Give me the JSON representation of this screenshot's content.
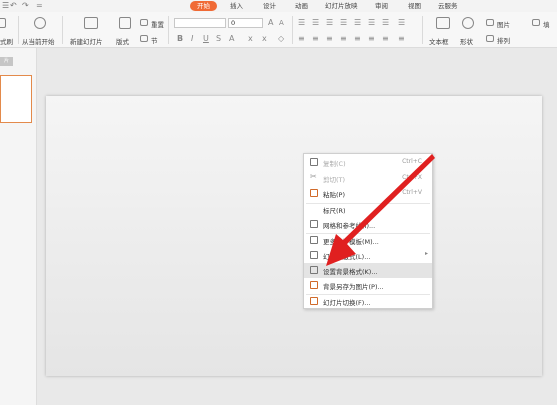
{
  "quick_access": {
    "logo_glyph": "☰",
    "undo_glyph": "↶",
    "redo_glyph": "↷",
    "more_glyph": "="
  },
  "tabs": [
    {
      "label": "开始",
      "active": true
    },
    {
      "label": "插入",
      "active": false
    },
    {
      "label": "设计",
      "active": false
    },
    {
      "label": "动画",
      "active": false
    },
    {
      "label": "幻灯片放映",
      "active": false
    },
    {
      "label": "审阅",
      "active": false
    },
    {
      "label": "视图",
      "active": false
    },
    {
      "label": "云服务",
      "active": false
    }
  ],
  "ribbon": {
    "format_painter_label": "式刷",
    "play_current_label": "从当前开始",
    "new_slide_label": "新建幻灯片",
    "layout_label": "版式",
    "reset_label": "重置",
    "section_label": "节",
    "font_size_value": "0",
    "textbox_label": "文本框",
    "shape_label": "形状",
    "picture_label": "图片",
    "arrange_label": "排列",
    "fill_label": "填"
  },
  "left_panel": {
    "tab_label": "片"
  },
  "context_menu": {
    "items": [
      {
        "label": "复制(C)",
        "shortcut": "Ctrl+C",
        "disabled": true,
        "icon": "copy-icon"
      },
      {
        "label": "剪切(T)",
        "shortcut": "Ctrl+X",
        "disabled": true,
        "icon": "scissors-icon"
      },
      {
        "label": "粘贴(P)",
        "shortcut": "Ctrl+V",
        "disabled": false,
        "icon": "paste-icon"
      },
      {
        "label": "标尺(R)",
        "shortcut": "",
        "disabled": false,
        "icon": ""
      },
      {
        "label": "网格和参考线(I)...",
        "shortcut": "",
        "disabled": false,
        "icon": "grid-icon"
      },
      {
        "label": "更多设计模板(M)...",
        "shortcut": "",
        "disabled": false,
        "icon": "template-icon"
      },
      {
        "label": "幻灯片版式(L)...",
        "shortcut": "",
        "disabled": false,
        "icon": "layout-icon",
        "submenu": true
      },
      {
        "label": "设置背景格式(K)...",
        "shortcut": "",
        "disabled": false,
        "icon": "background-icon",
        "highlighted": true
      },
      {
        "label": "背景另存为图片(P)...",
        "shortcut": "",
        "disabled": false,
        "icon": "save-image-icon"
      },
      {
        "label": "幻灯片切换(F)...",
        "shortcut": "",
        "disabled": false,
        "icon": "transition-icon"
      }
    ]
  },
  "annotation": {
    "arrow_color": "#e02020",
    "points_to": "设置背景格式(K)..."
  },
  "colors": {
    "accent": "#f06a35",
    "selection_border": "#e38a4b"
  }
}
